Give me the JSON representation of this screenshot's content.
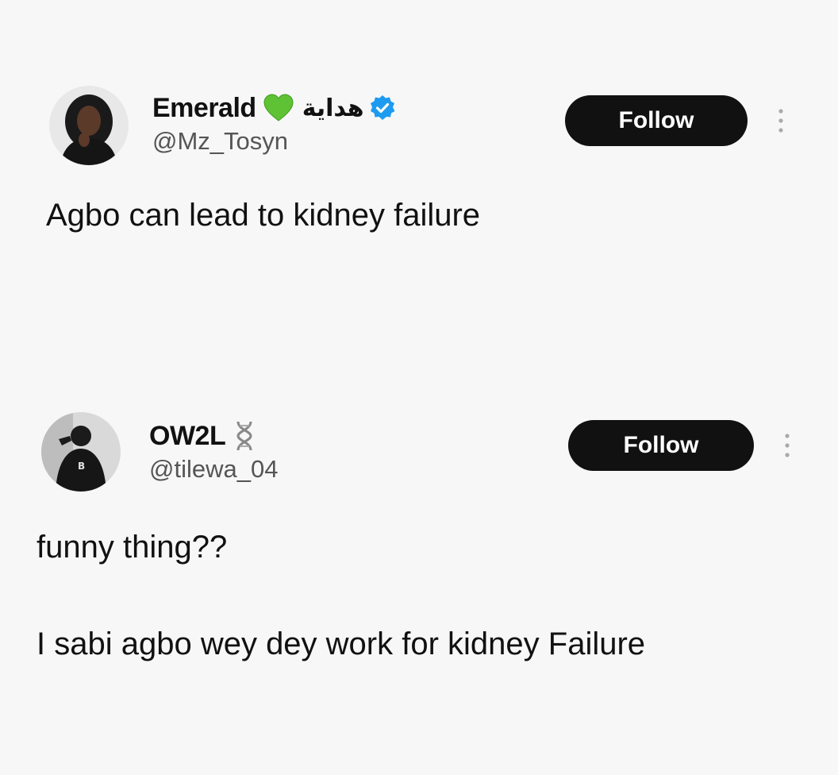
{
  "tweets": [
    {
      "display_name": "Emerald",
      "name_suffix": "هداية",
      "handle": "@Mz_Tosyn",
      "follow_label": "Follow",
      "text": "Agbo can lead to kidney failure",
      "icons": [
        "green-heart-icon",
        "verified-badge-icon",
        "more-options-icon"
      ],
      "colors": {
        "heart": "#5fc234",
        "verified": "#1d9bf0"
      }
    },
    {
      "display_name": "OW2L",
      "handle": "@tilewa_04",
      "follow_label": "Follow",
      "text_lines": [
        "funny thing??",
        "I sabi agbo wey dey work for kidney Failure"
      ],
      "icons": [
        "dna-icon",
        "more-options-icon"
      ]
    }
  ],
  "colors": {
    "background": "#f7f7f7",
    "button": "#111111",
    "button_text": "#ffffff"
  }
}
